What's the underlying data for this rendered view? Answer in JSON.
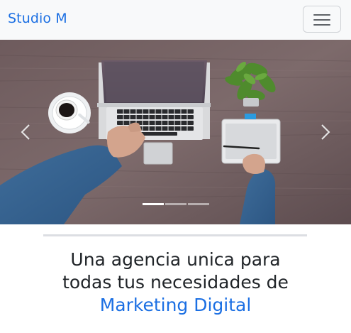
{
  "navbar": {
    "brand": "Studio M",
    "toggler_icon": "hamburger-menu-icon"
  },
  "carousel": {
    "image": "workspace-desk-photo",
    "prev_icon": "chevron-left-icon",
    "next_icon": "chevron-right-icon",
    "slide_count": 3,
    "active_slide": 1
  },
  "hero": {
    "headline_line1": "Una agencia unica para",
    "headline_line2": "todas tus necesidades de",
    "headline_accent": "Marketing Digital"
  },
  "colors": {
    "accent": "#1b6fe3",
    "navbar_bg": "#f8f9fa",
    "text": "#212529"
  }
}
